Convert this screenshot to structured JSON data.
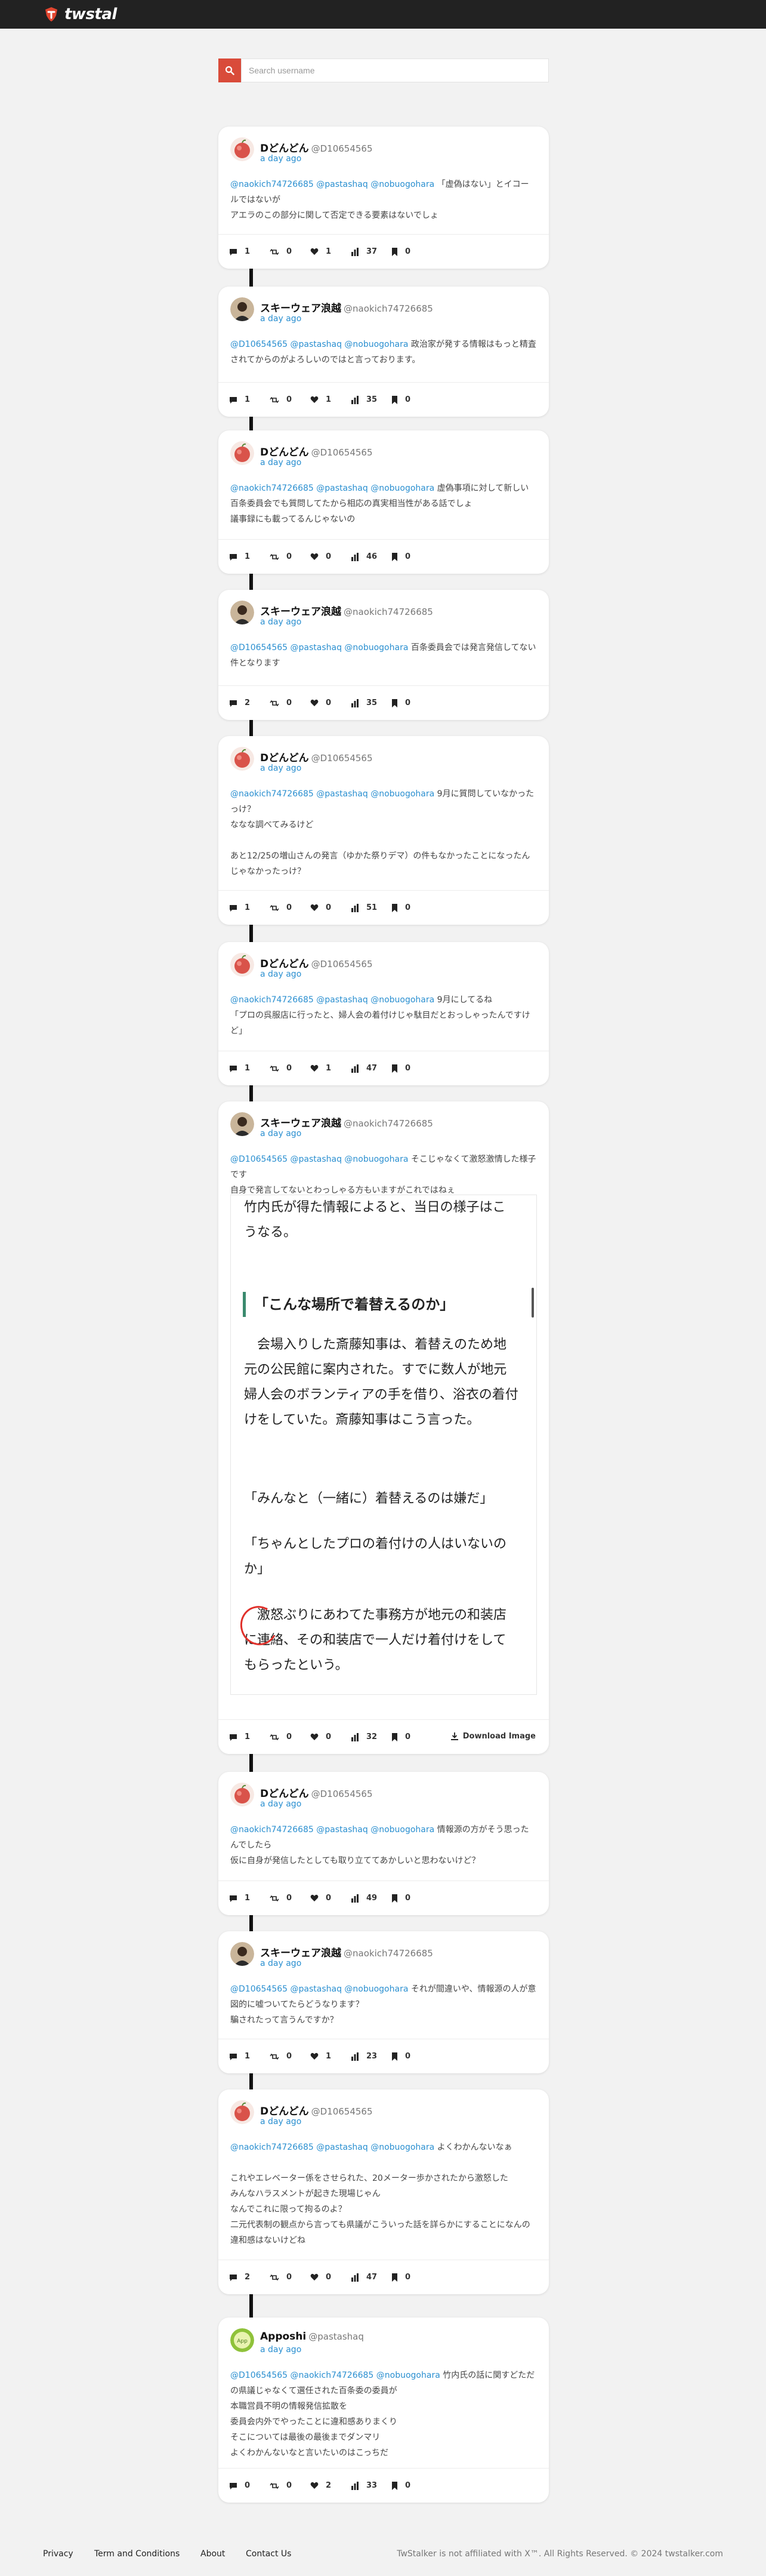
{
  "app": {
    "logo_text": "twstal",
    "brand_color": "#d94b3a"
  },
  "search": {
    "placeholder": "Search username"
  },
  "download_label": "Download Image",
  "posts": [
    {
      "name": "Dどんどん",
      "handle": "@D10654565",
      "time": "a day ago",
      "mentions": "@naokich74726685 @pastashaq @nobuogohara",
      "lines": [
        "「虚偽はない」とイコールではないが",
        "アエラのこの部分に関して否定できる要素はないでしょ"
      ],
      "stats": {
        "replies": "1",
        "retweets": "0",
        "likes": "1",
        "views": "37",
        "bookmarks": "0"
      }
    },
    {
      "name": "スキーウェア浪越",
      "handle": "@naokich74726685",
      "time": "a day ago",
      "mentions": "@D10654565 @pastashaq @nobuogohara",
      "lines": [
        "政治家が発する情報はもっと精査されてからのがよろしいのではと言っております。"
      ],
      "stats": {
        "replies": "1",
        "retweets": "0",
        "likes": "1",
        "views": "35",
        "bookmarks": "0"
      }
    },
    {
      "name": "Dどんどん",
      "handle": "@D10654565",
      "time": "a day ago",
      "mentions": "@naokich74726685 @pastashaq @nobuogohara",
      "lines": [
        "虚偽事項に対して新しい百条委員会でも質問してたから相応の真実相当性がある話でしょ",
        "議事録にも載ってるんじゃないの"
      ],
      "stats": {
        "replies": "1",
        "retweets": "0",
        "likes": "0",
        "views": "46",
        "bookmarks": "0"
      }
    },
    {
      "name": "スキーウェア浪越",
      "handle": "@naokich74726685",
      "time": "a day ago",
      "mentions": "@D10654565 @pastashaq @nobuogohara",
      "lines": [
        "百条委員会では発言発信してない件となります"
      ],
      "stats": {
        "replies": "2",
        "retweets": "0",
        "likes": "0",
        "views": "35",
        "bookmarks": "0"
      }
    },
    {
      "name": "Dどんどん",
      "handle": "@D10654565",
      "time": "a day ago",
      "mentions": "@naokich74726685 @pastashaq @nobuogohara",
      "lines": [
        "9月に質問していなかったっけ？",
        "ななな調べてみるけど",
        "",
        "あと12/25の増山さんの発言（ゆかた祭りデマ）の件もなかったことになったんじゃなかったっけ？"
      ],
      "stats": {
        "replies": "1",
        "retweets": "0",
        "likes": "0",
        "views": "51",
        "bookmarks": "0"
      }
    },
    {
      "name": "Dどんどん",
      "handle": "@D10654565",
      "time": "a day ago",
      "mentions": "@naokich74726685 @pastashaq @nobuogohara",
      "lines": [
        "9月にしてるね",
        "「プロの呉服店に行ったと、婦人会の着付けじゃ駄目だとおっしゃったんですけど」"
      ],
      "stats": {
        "replies": "1",
        "retweets": "0",
        "likes": "1",
        "views": "47",
        "bookmarks": "0"
      }
    },
    {
      "name": "スキーウェア浪越",
      "handle": "@naokich74726685",
      "time": "a day ago",
      "mentions": "@D10654565 @pastashaq @nobuogohara",
      "lines": [
        "そこじゃなくて激怒激情した様子です",
        "自身で発言してないとわっしゃる方もいますがこれではねぇ"
      ],
      "article": {
        "intro": "竹内氏が得た情報によると、当日の様子はこうなる。",
        "heading": "「こんな場所で着替えるのか」",
        "para1": "会場入りした斎藤知事は、着替えのため地元の公民館に案内された。すでに数人が地元婦人会のボランティアの手を借り、浴衣の着付けをしていた。斎藤知事はこう言った。",
        "quote1": "「みんなと（一緒に）着替えるのは嫌だ」",
        "quote2": "「ちゃんとしたプロの着付けの人はいないのか」",
        "para2": "激怒ぶりにあわてた事務方が地元の和装店に連絡、その和装店で一人だけ着付けをしてもらったという。"
      },
      "stats": {
        "replies": "1",
        "retweets": "0",
        "likes": "0",
        "views": "32",
        "bookmarks": "0"
      }
    },
    {
      "name": "Dどんどん",
      "handle": "@D10654565",
      "time": "a day ago",
      "mentions": "@naokich74726685 @pastashaq @nobuogohara",
      "lines": [
        "情報源の方がそう思ったんでしたら",
        "仮に自身が発信したとしても取り立ててあかしいと思わないけど？"
      ],
      "stats": {
        "replies": "1",
        "retweets": "0",
        "likes": "0",
        "views": "49",
        "bookmarks": "0"
      }
    },
    {
      "name": "スキーウェア浪越",
      "handle": "@naokich74726685",
      "time": "a day ago",
      "mentions": "@D10654565 @pastashaq @nobuogohara",
      "lines": [
        "それが間違いや、情報源の人が意図的に嘘ついてたらどうなります？",
        "騙されたって言うんですか？"
      ],
      "stats": {
        "replies": "1",
        "retweets": "0",
        "likes": "1",
        "views": "23",
        "bookmarks": "0"
      }
    },
    {
      "name": "Dどんどん",
      "handle": "@D10654565",
      "time": "a day ago",
      "mentions": "@naokich74726685 @pastashaq @nobuogohara",
      "lines": [
        "よくわかんないなぁ",
        "",
        "これやエレベーター係をさせられた、20メーター歩かされたから激怒した",
        "みんなハラスメントが起きた現場じゃん",
        "なんでこれに限って拘るのよ？",
        "二元代表制の観点から言っても県議がこういった話を詳らかにすることになんの違和感はないけどね"
      ],
      "stats": {
        "replies": "2",
        "retweets": "0",
        "likes": "0",
        "views": "47",
        "bookmarks": "0"
      }
    },
    {
      "name": "Apposhi",
      "handle": "@pastashaq",
      "time": "a day ago",
      "mentions": "@D10654565 @naokich74726685 @nobuogohara",
      "lines": [
        "竹内氏の話に関すどただの県議じゃなくて選任された百条委の委員が",
        "本職営員不明の情報発信拡散を",
        "委員会内外でやったことに違和感ありまくり",
        "そこについては最後の最後までダンマリ",
        "よくわかんないなと言いたいのはこっちだ"
      ],
      "stats": {
        "replies": "0",
        "retweets": "0",
        "likes": "2",
        "views": "33",
        "bookmarks": "0"
      }
    }
  ],
  "footer": {
    "links": [
      "Privacy",
      "Term and Conditions",
      "About",
      "Contact Us"
    ],
    "notice": "TwStalker is not affiliated with X™. All Rights Reserved. © 2024 twstalker.com"
  }
}
